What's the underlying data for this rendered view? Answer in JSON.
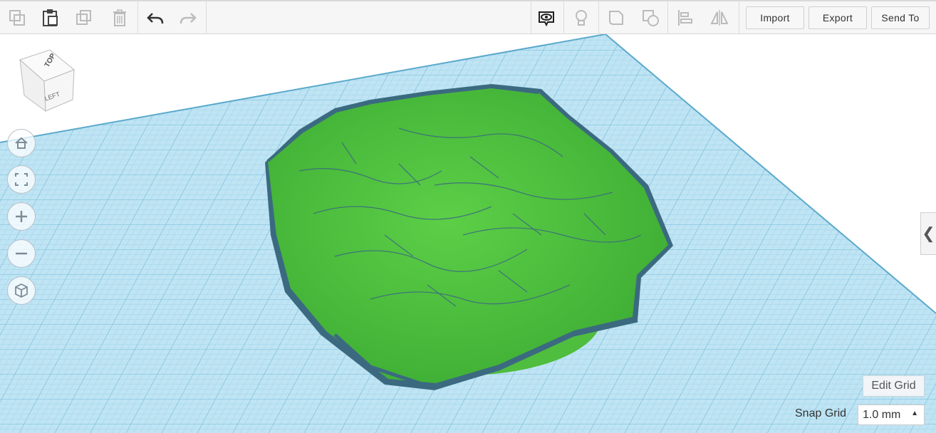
{
  "toolbar": {
    "buttons": {
      "copy": "copy-icon",
      "paste": "paste-icon",
      "duplicate": "duplicate-icon",
      "delete": "trash-icon",
      "undo": "undo-icon",
      "redo": "redo-icon",
      "show_all": "eye-icon",
      "notes": "lightbulb-icon",
      "shape_hole": "shape-icon",
      "group": "group-icon",
      "align": "align-icon",
      "mirror": "mirror-icon"
    },
    "import_label": "Import",
    "export_label": "Export",
    "send_to_label": "Send To"
  },
  "viewcube": {
    "top": "TOP",
    "left": "LEFT"
  },
  "nav": [
    "home-icon",
    "fit-icon",
    "zoom-in-icon",
    "zoom-out-icon",
    "perspective-icon"
  ],
  "side_panel": {
    "toggle": "chevron-left-icon",
    "glyph": "❮"
  },
  "grid": {
    "edit_label": "Edit Grid",
    "snap_label": "Snap Grid",
    "snap_value": "1.0 mm"
  },
  "colors": {
    "workplane": "#b7e0f1",
    "grid_line": "#7fc3df",
    "model": "#4cbc3c",
    "model_dark": "#3b6a80",
    "toolbar": "#f6f6f6"
  }
}
